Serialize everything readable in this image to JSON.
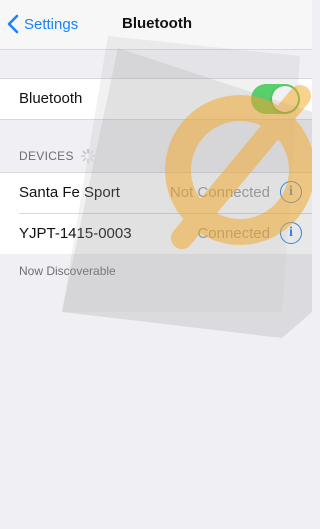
{
  "navbar": {
    "back_label": "Settings",
    "title": "Bluetooth"
  },
  "bluetooth_row": {
    "label": "Bluetooth",
    "toggle_on": true
  },
  "devices": {
    "header": "DEVICES",
    "items": [
      {
        "name": "Santa Fe Sport",
        "status": "Not Connected",
        "info": "i"
      },
      {
        "name": "YJPT-1415-0003",
        "status": "Connected",
        "info": "i"
      }
    ],
    "footer": "Now Discoverable"
  },
  "colors": {
    "accent": "#1a82fb",
    "toggle_on": "#4cd964",
    "background": "#efeff4",
    "watermark_orange": "#f5a623"
  },
  "icons": {
    "back": "chevron-left-icon",
    "spinner": "activity-spinner-icon",
    "info": "info-circle-icon"
  }
}
